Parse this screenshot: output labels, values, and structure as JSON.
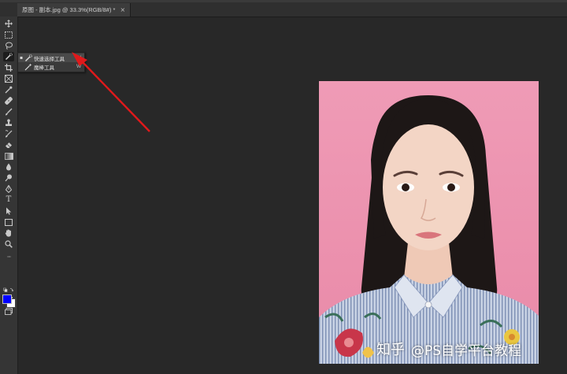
{
  "document_tab": {
    "title": "原图 - 副本.jpg @ 33.3%(RGB/8#) *",
    "close_glyph": "×"
  },
  "toolbar": {
    "tools": [
      {
        "name": "move-tool",
        "icon": "move-icon"
      },
      {
        "name": "marquee-tool",
        "icon": "rect-marquee-icon"
      },
      {
        "name": "lasso-tool",
        "icon": "lasso-icon"
      },
      {
        "name": "quick-selection-tool",
        "icon": "quick-selection-icon",
        "active": true
      },
      {
        "name": "crop-tool",
        "icon": "crop-icon"
      },
      {
        "name": "frame-tool",
        "icon": "frame-icon"
      },
      {
        "name": "eyedropper-tool",
        "icon": "eyedropper-icon"
      },
      {
        "name": "healing-brush-tool",
        "icon": "bandage-icon"
      },
      {
        "name": "brush-tool",
        "icon": "brush-icon"
      },
      {
        "name": "clone-stamp-tool",
        "icon": "stamp-icon"
      },
      {
        "name": "history-brush-tool",
        "icon": "history-brush-icon"
      },
      {
        "name": "eraser-tool",
        "icon": "eraser-icon"
      },
      {
        "name": "gradient-tool",
        "icon": "gradient-icon"
      },
      {
        "name": "blur-tool",
        "icon": "drop-icon"
      },
      {
        "name": "dodge-tool",
        "icon": "dodge-icon"
      },
      {
        "name": "pen-tool",
        "icon": "pen-icon"
      },
      {
        "name": "type-tool",
        "icon": "type-icon"
      },
      {
        "name": "path-selection-tool",
        "icon": "path-select-icon"
      },
      {
        "name": "rectangle-tool",
        "icon": "rectangle-icon"
      },
      {
        "name": "hand-tool",
        "icon": "hand-icon"
      },
      {
        "name": "zoom-tool",
        "icon": "zoom-icon"
      },
      {
        "name": "more-tools",
        "icon": "ellipsis-icon"
      }
    ],
    "type_glyph": "T",
    "more_glyph": "···",
    "foreground_color": "#0000ff",
    "background_color": "#ffffff"
  },
  "tool_flyout": {
    "items": [
      {
        "label": "快速选择工具",
        "shortcut": "W",
        "selected": true,
        "bullet": "▪"
      },
      {
        "label": "魔棒工具",
        "shortcut": "W",
        "selected": false,
        "bullet": ""
      }
    ]
  },
  "annotation": {
    "arrow_color": "#e0191b"
  },
  "canvas": {
    "background_color": "#ee9ab4"
  },
  "watermark": {
    "platform": "知乎",
    "handle": "@PS自学平台教程"
  }
}
